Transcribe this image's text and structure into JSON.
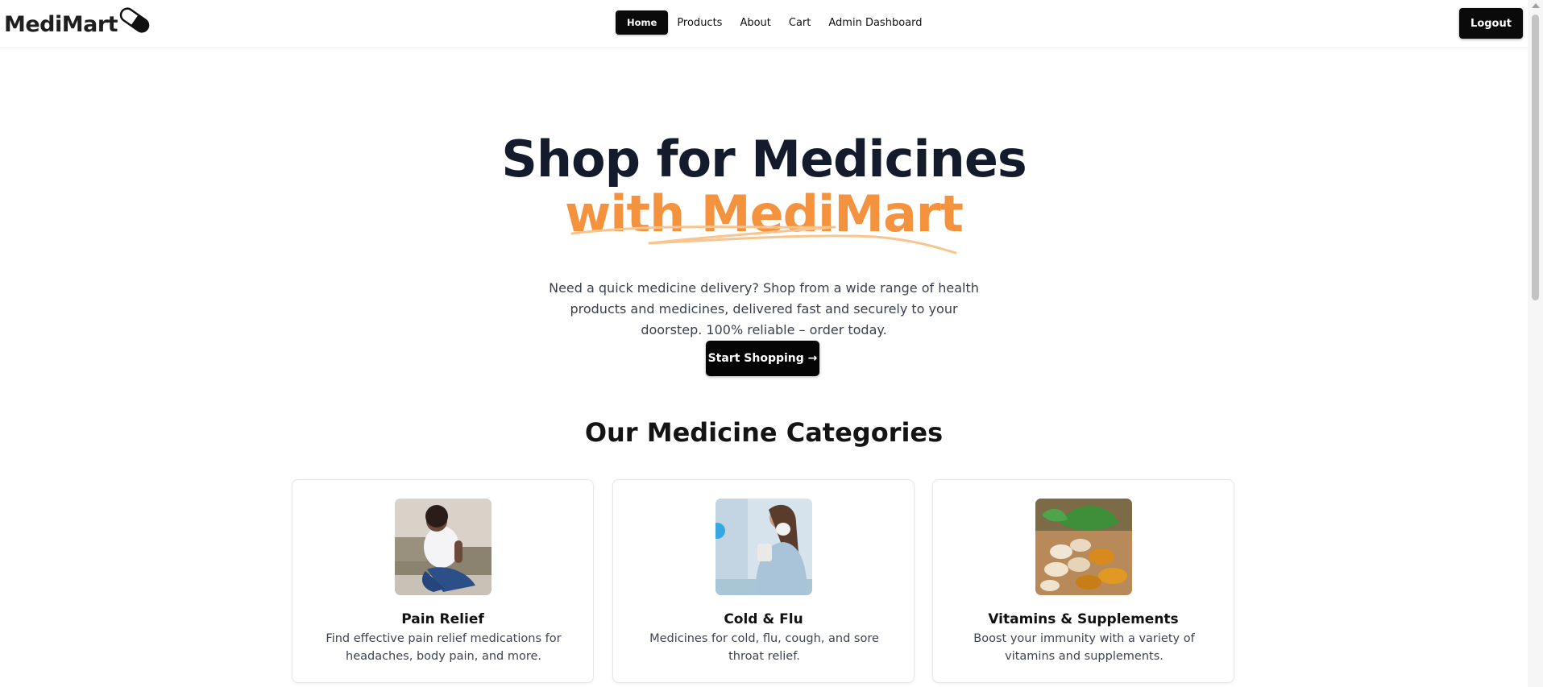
{
  "header": {
    "logo_text": "MediMart",
    "logo_icon": "pill-icon",
    "nav": [
      {
        "label": "Home",
        "active": true
      },
      {
        "label": "Products",
        "active": false
      },
      {
        "label": "About",
        "active": false
      },
      {
        "label": "Cart",
        "active": false
      },
      {
        "label": "Admin Dashboard",
        "active": false
      }
    ],
    "logout_label": "Logout"
  },
  "hero": {
    "title_line1": "Shop for Medicines",
    "title_line2": "with MediMart",
    "description": "Need a quick medicine delivery? Shop from a wide range of health products and medicines, delivered fast and securely to your doorstep. 100% reliable – order today.",
    "cta_label": "Start Shopping →"
  },
  "categories": {
    "title": "Our Medicine Categories",
    "items": [
      {
        "title": "Pain Relief",
        "description": "Find effective pain relief medications for headaches, body pain, and more."
      },
      {
        "title": "Cold & Flu",
        "description": "Medicines for cold, flu, cough, and sore throat relief."
      },
      {
        "title": "Vitamins & Supplements",
        "description": "Boost your immunity with a variety of vitamins and supplements."
      }
    ]
  },
  "colors": {
    "accent": "#f5923e",
    "heading": "#141b2d",
    "button": "#0a0a0a"
  }
}
